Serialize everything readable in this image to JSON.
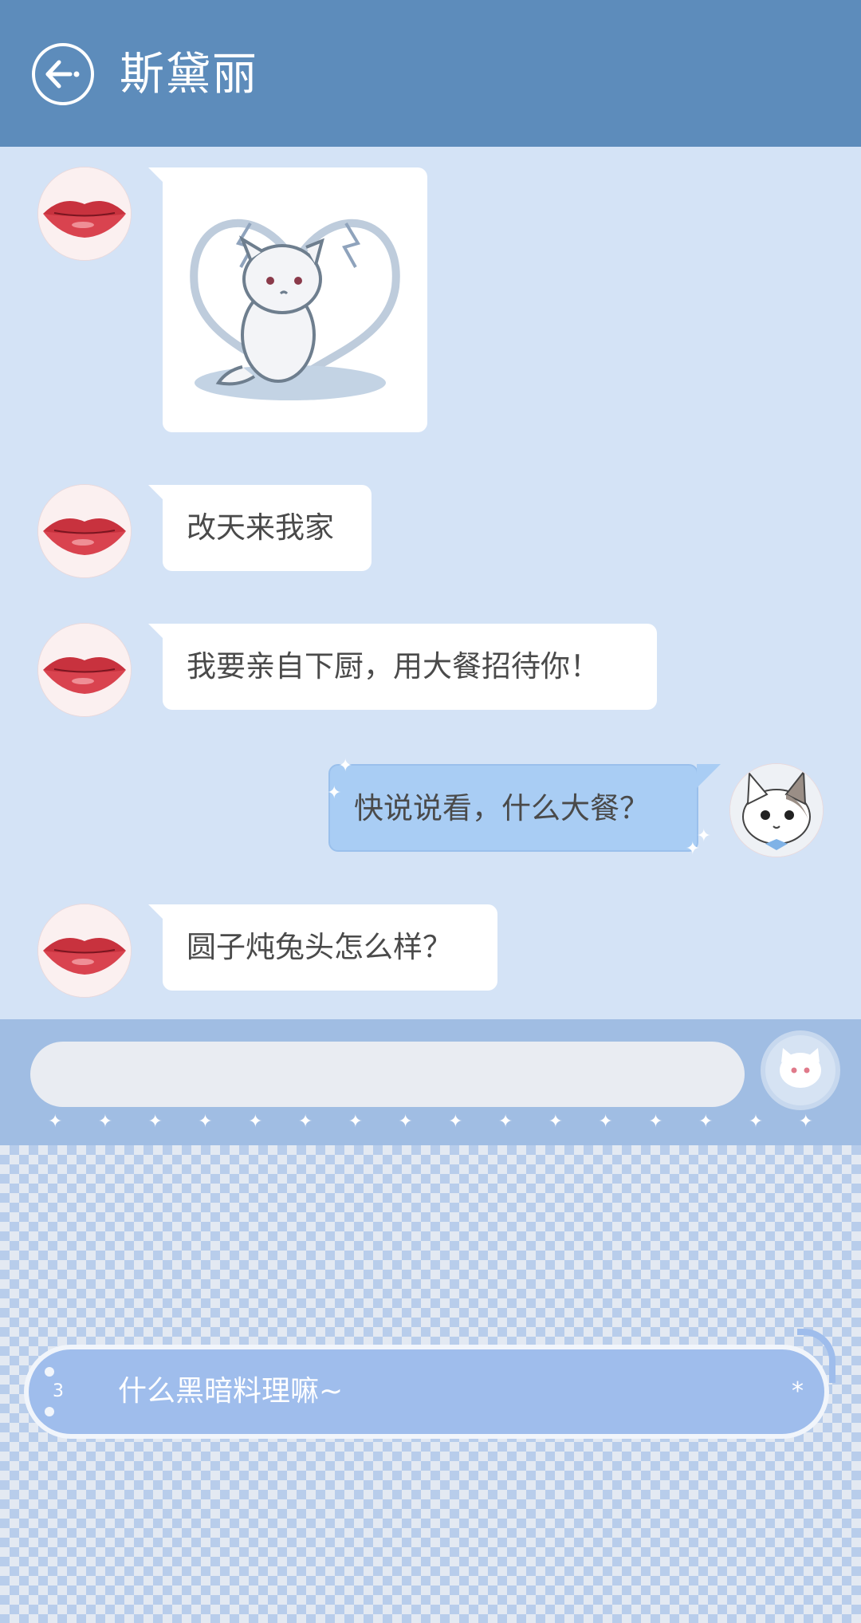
{
  "header": {
    "title": "斯黛丽"
  },
  "messages": [
    {
      "type": "sticker",
      "from": "other"
    },
    {
      "type": "text",
      "from": "other",
      "text": "改天来我家"
    },
    {
      "type": "text",
      "from": "other",
      "text": "我要亲自下厨，用大餐招待你！"
    },
    {
      "type": "text",
      "from": "me",
      "text": "快说说看，什么大餐？"
    },
    {
      "type": "text",
      "from": "other",
      "text": "圆子炖兔头怎么样？"
    }
  ],
  "input": {
    "placeholder": ""
  },
  "suggestion": {
    "index": "3",
    "text": "什么黑暗料理嘛~",
    "end_mark": "*"
  },
  "colors": {
    "header": "#5d8cbb",
    "chat_background": "#d4e3f6",
    "my_bubble": "#a9cdf4",
    "input_bar": "#a0bde3",
    "suggestion": "#9fbdec"
  },
  "icons": {
    "back": "back-arrow-icon",
    "send": "cat-face-icon",
    "avatar_other": "lips-avatar",
    "avatar_me": "cat-avatar"
  }
}
